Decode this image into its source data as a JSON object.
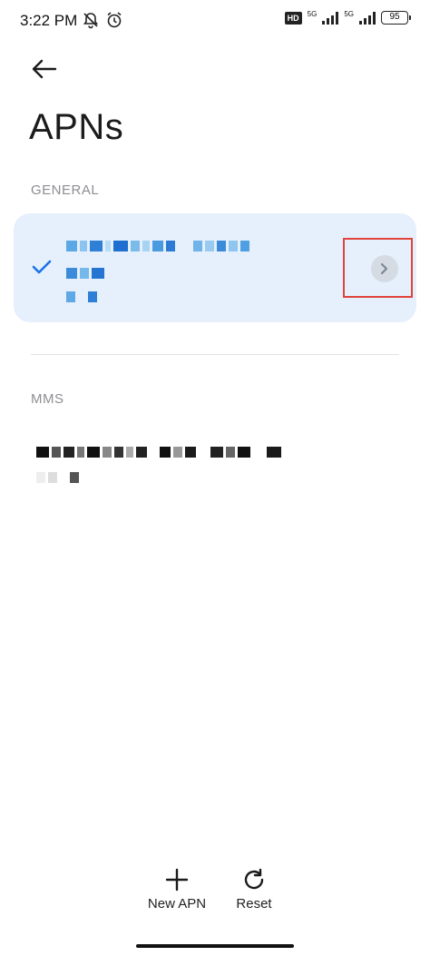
{
  "status_bar": {
    "time": "3:22 PM",
    "hd_label": "HD",
    "network1": "5G",
    "network2": "5G",
    "battery": "95"
  },
  "header": {
    "title": "APNs"
  },
  "sections": {
    "general": "GENERAL",
    "mms": "MMS"
  },
  "actions": {
    "new_apn": "New APN",
    "reset": "Reset"
  },
  "colors": {
    "accent": "#1a73e8",
    "card_bg": "#e5f0fc",
    "highlight": "#e0443a"
  }
}
